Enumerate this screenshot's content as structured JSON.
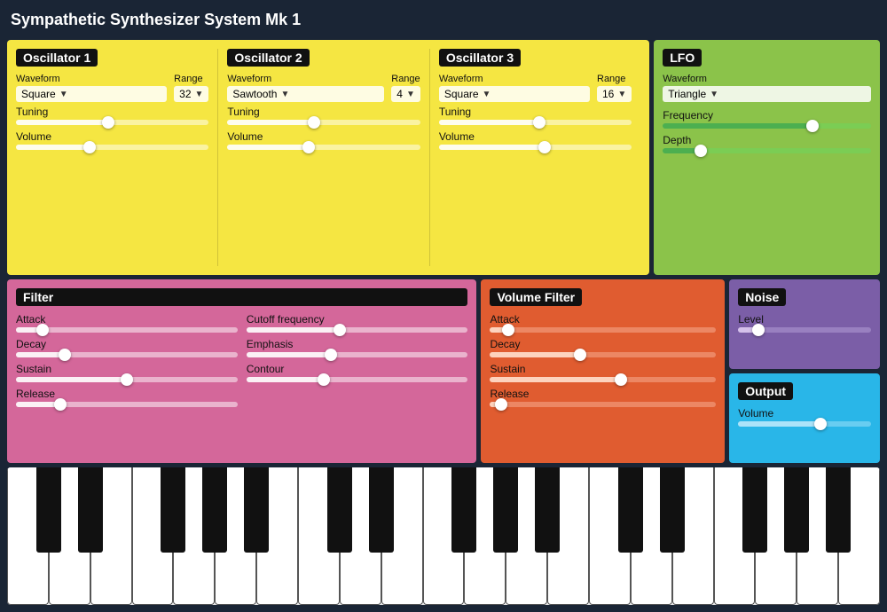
{
  "title": "Sympathetic Synthesizer System Mk 1",
  "oscillators": {
    "label": "Oscillator 1",
    "osc1": {
      "label": "Oscillator 1",
      "waveform_label": "Waveform",
      "waveform_value": "Square",
      "range_label": "Range",
      "range_value": "32",
      "tuning_label": "Tuning",
      "tuning_pct": 48,
      "volume_label": "Volume",
      "volume_pct": 38
    },
    "osc2": {
      "label": "Oscillator 2",
      "waveform_label": "Waveform",
      "waveform_value": "Sawtooth",
      "range_label": "Range",
      "range_value": "4",
      "tuning_label": "Tuning",
      "tuning_pct": 45,
      "volume_label": "Volume",
      "volume_pct": 42
    },
    "osc3": {
      "label": "Oscillator 3",
      "waveform_label": "Waveform",
      "waveform_value": "Square",
      "range_label": "Range",
      "range_value": "16",
      "tuning_label": "Tuning",
      "tuning_pct": 52,
      "volume_label": "Volume",
      "volume_pct": 55
    }
  },
  "lfo": {
    "label": "LFO",
    "waveform_label": "Waveform",
    "waveform_value": "Triangle",
    "frequency_label": "Frequency",
    "frequency_pct": 72,
    "depth_label": "Depth",
    "depth_pct": 18
  },
  "filter": {
    "label": "Filter",
    "attack_label": "Attack",
    "attack_pct": 12,
    "decay_label": "Decay",
    "decay_pct": 22,
    "sustain_label": "Sustain",
    "sustain_pct": 50,
    "release_label": "Release",
    "release_pct": 20,
    "cutoff_label": "Cutoff frequency",
    "cutoff_pct": 42,
    "emphasis_label": "Emphasis",
    "emphasis_pct": 38,
    "contour_label": "Contour",
    "contour_pct": 35
  },
  "volume_filter": {
    "label": "Volume Filter",
    "attack_label": "Attack",
    "attack_pct": 8,
    "decay_label": "Decay",
    "decay_pct": 40,
    "sustain_label": "Sustain",
    "sustain_pct": 58,
    "release_label": "Release",
    "release_pct": 5
  },
  "noise": {
    "label": "Noise",
    "level_label": "Level",
    "level_pct": 15
  },
  "output": {
    "label": "Output",
    "volume_label": "Volume",
    "volume_pct": 62
  }
}
